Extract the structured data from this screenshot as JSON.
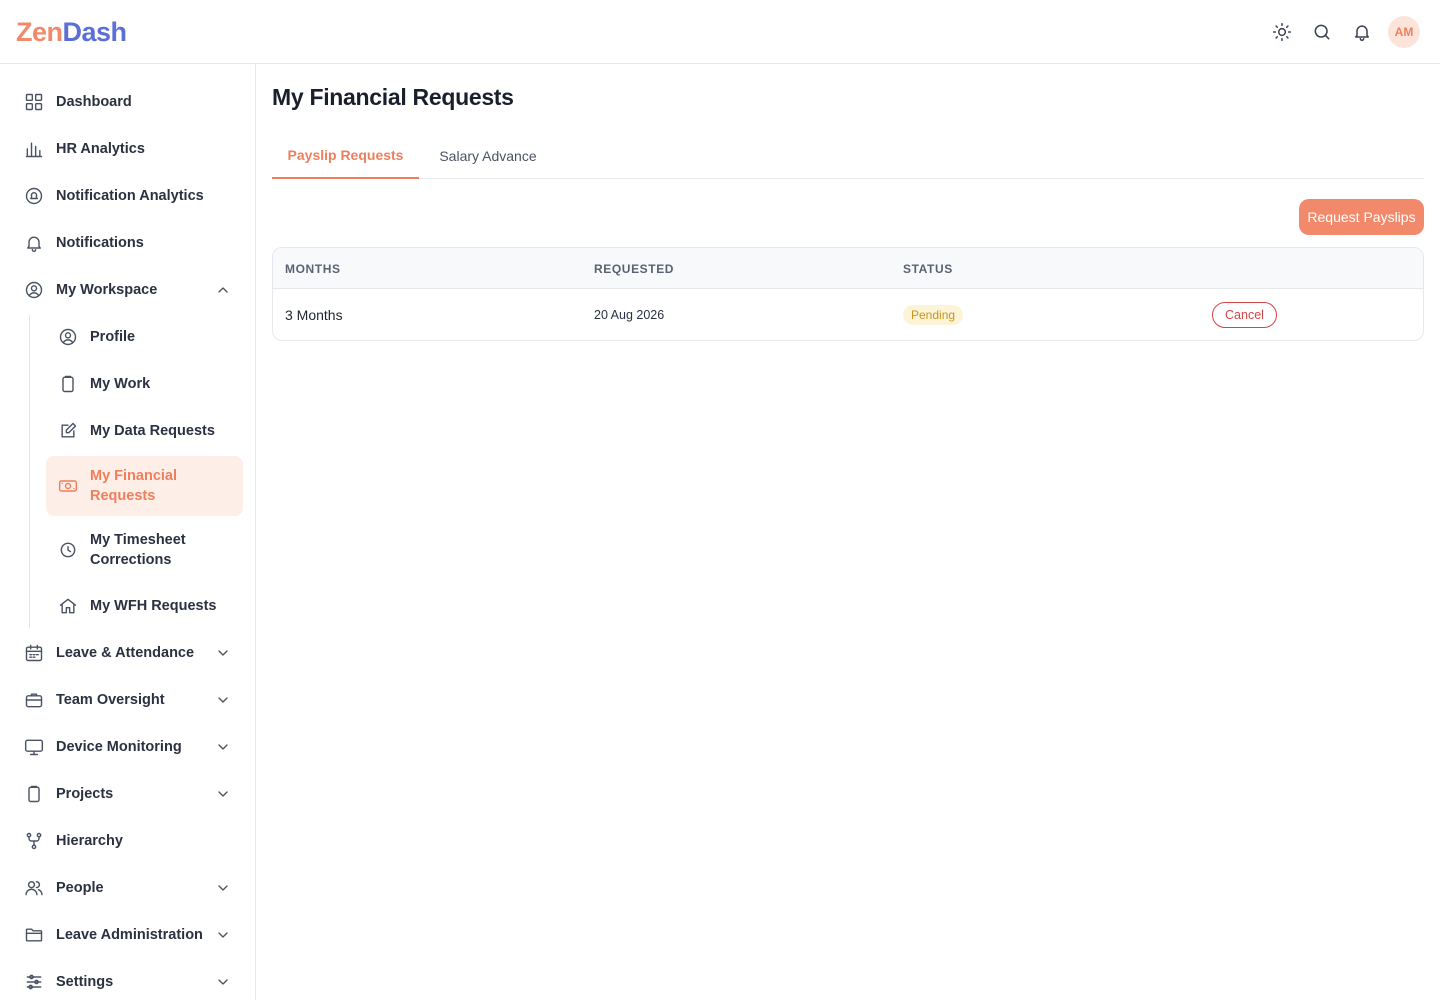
{
  "app": {
    "logo_part1": "Zen",
    "logo_part2": "Dash",
    "avatar_initials": "AM"
  },
  "colors": {
    "accent": "#f2896b",
    "accent_text": "#ef7f5c",
    "active_bg": "#fdeee8",
    "pending_bg": "#fdf4d8",
    "pending_text": "#c8941a",
    "danger": "#d64545"
  },
  "topbar": {
    "icons": [
      "sun-icon",
      "search-icon",
      "bell-icon"
    ]
  },
  "sidebar": {
    "items": [
      {
        "label": "Dashboard",
        "icon": "grid-icon"
      },
      {
        "label": "HR Analytics",
        "icon": "bar-chart-icon"
      },
      {
        "label": "Notification Analytics",
        "icon": "bell-circle-icon"
      },
      {
        "label": "Notifications",
        "icon": "bell-icon"
      },
      {
        "label": "My Workspace",
        "icon": "user-circle-icon",
        "expanded": true
      },
      {
        "label": "Leave & Attendance",
        "icon": "calendar-icon"
      },
      {
        "label": "Team Oversight",
        "icon": "briefcase-icon"
      },
      {
        "label": "Device Monitoring",
        "icon": "monitor-icon"
      },
      {
        "label": "Projects",
        "icon": "clipboard-icon"
      },
      {
        "label": "Hierarchy",
        "icon": "fork-icon"
      },
      {
        "label": "People",
        "icon": "users-icon"
      },
      {
        "label": "Leave Administration",
        "icon": "folder-icon"
      },
      {
        "label": "Settings",
        "icon": "sliders-icon"
      }
    ],
    "workspace_items": [
      {
        "label": "Profile",
        "icon": "user-circle-icon"
      },
      {
        "label": "My Work",
        "icon": "clipboard-icon"
      },
      {
        "label": "My Data Requests",
        "icon": "edit-icon"
      },
      {
        "label": "My Financial Requests",
        "icon": "cash-icon",
        "active": true
      },
      {
        "label": "My Timesheet Corrections",
        "icon": "clock-icon"
      },
      {
        "label": "My WFH Requests",
        "icon": "home-icon"
      }
    ]
  },
  "main": {
    "title": "My Financial Requests",
    "tabs": [
      {
        "label": "Payslip Requests",
        "active": true
      },
      {
        "label": "Salary Advance",
        "active": false
      }
    ],
    "request_button": "Request Payslips",
    "table": {
      "columns": [
        "MONTHS",
        "REQUESTED",
        "STATUS"
      ],
      "rows": [
        {
          "months": "3 Months",
          "requested": "20 Aug 2026",
          "status": "Pending",
          "action": "Cancel"
        }
      ]
    }
  }
}
